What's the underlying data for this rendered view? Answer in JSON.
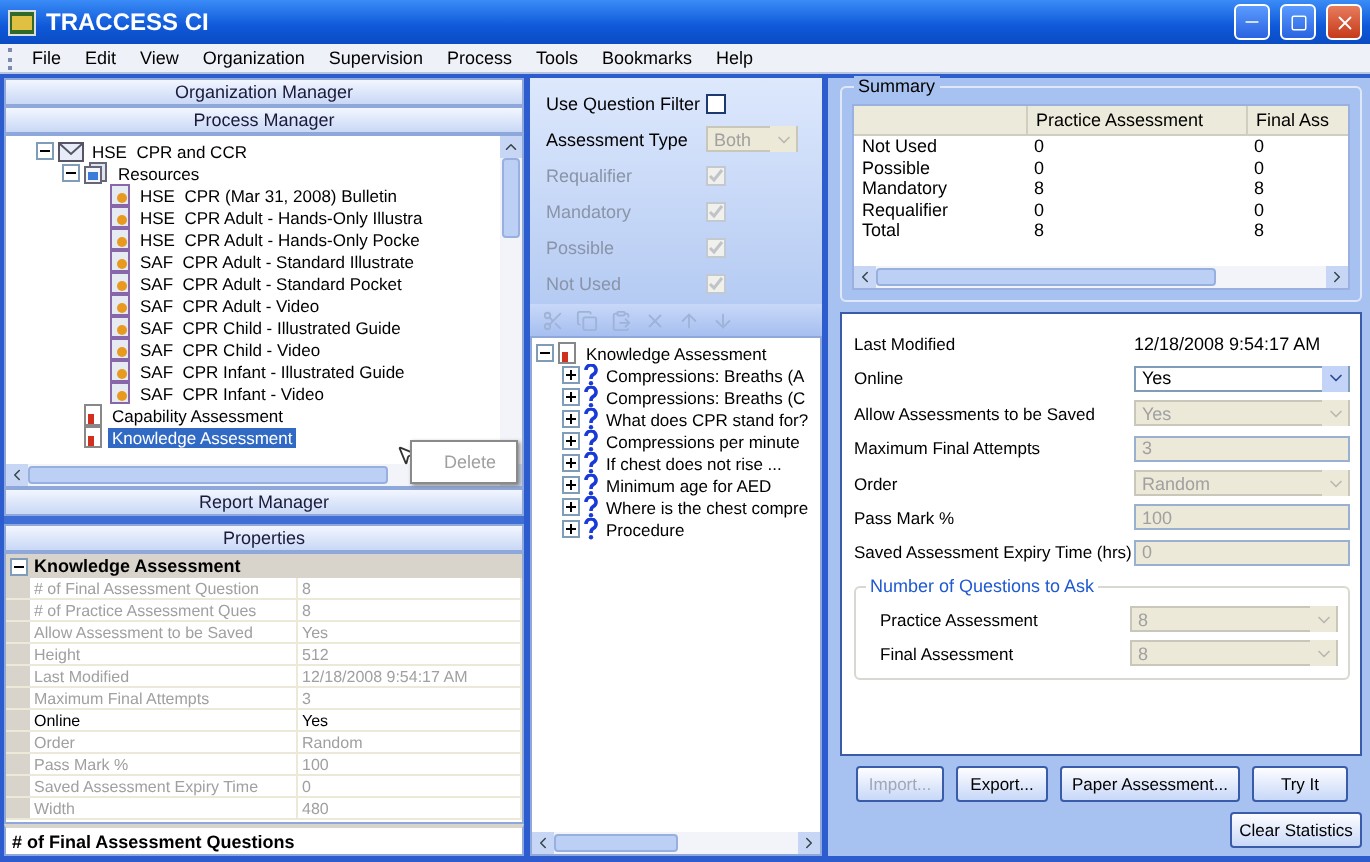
{
  "window": {
    "title": "TRACCESS CI"
  },
  "menu": [
    "File",
    "Edit",
    "View",
    "Organization",
    "Supervision",
    "Process",
    "Tools",
    "Bookmarks",
    "Help"
  ],
  "left_panel": {
    "organization_manager": {
      "title": "Organization Manager"
    },
    "process_manager": {
      "title": "Process Manager",
      "tree": [
        {
          "label": "HSE  CPR and CCR",
          "kind": "course",
          "expanded": true,
          "selected": false,
          "children": [
            {
              "label": "Resources",
              "kind": "folder",
              "expanded": true,
              "selected": false,
              "children": [
                {
                  "label": "HSE  CPR (Mar 31, 2008) Bulletin",
                  "kind": "resource",
                  "selected": false
                },
                {
                  "label": "HSE  CPR Adult - Hands-Only Illustra",
                  "kind": "resource",
                  "selected": false
                },
                {
                  "label": "HSE  CPR Adult - Hands-Only Pocke",
                  "kind": "resource",
                  "selected": false
                },
                {
                  "label": "SAF  CPR Adult - Standard Illustrate",
                  "kind": "resource",
                  "selected": false
                },
                {
                  "label": "SAF  CPR Adult - Standard Pocket",
                  "kind": "resource",
                  "selected": false
                },
                {
                  "label": "SAF  CPR Adult - Video",
                  "kind": "resource",
                  "selected": false
                },
                {
                  "label": "SAF  CPR Child - Illustrated Guide",
                  "kind": "resource",
                  "selected": false
                },
                {
                  "label": "SAF  CPR Child - Video",
                  "kind": "resource",
                  "selected": false
                },
                {
                  "label": "SAF  CPR Infant - Illustrated Guide",
                  "kind": "resource",
                  "selected": false
                },
                {
                  "label": "SAF  CPR Infant - Video",
                  "kind": "resource",
                  "selected": false
                }
              ]
            },
            {
              "label": "Capability Assessment",
              "kind": "assessment",
              "selected": false
            },
            {
              "label": "Knowledge Assessment",
              "kind": "assessment",
              "selected": true
            }
          ]
        }
      ]
    },
    "context_menu": {
      "items": [
        {
          "label": "Delete",
          "disabled": true
        }
      ]
    },
    "report_manager": {
      "title": "Report Manager"
    },
    "properties": {
      "title": "Properties",
      "category": {
        "label": "Knowledge Assessment",
        "expanded": true
      },
      "rows": [
        {
          "name": "# of Final Assessment Question",
          "value": "8",
          "disabled": true
        },
        {
          "name": "# of Practice Assessment Ques",
          "value": "8",
          "disabled": true
        },
        {
          "name": "Allow Assessment to be Saved",
          "value": "Yes",
          "disabled": true
        },
        {
          "name": "Height",
          "value": "512",
          "disabled": true
        },
        {
          "name": "Last Modified",
          "value": "12/18/2008 9:54:17 AM",
          "disabled": true
        },
        {
          "name": "Maximum Final Attempts",
          "value": "3",
          "disabled": true
        },
        {
          "name": "Online",
          "value": "Yes",
          "disabled": false
        },
        {
          "name": "Order",
          "value": "Random",
          "disabled": true
        },
        {
          "name": "Pass Mark %",
          "value": "100",
          "disabled": true
        },
        {
          "name": "Saved Assessment Expiry Time",
          "value": "0",
          "disabled": true
        },
        {
          "name": "Width",
          "value": "480",
          "disabled": true
        }
      ],
      "description": "# of Final Assessment Questions"
    }
  },
  "question_panel": {
    "filter": {
      "use_filter": {
        "label": "Use Question Filter",
        "checked": false
      },
      "assessment_type": {
        "label": "Assessment Type",
        "value": "Both",
        "disabled": true
      },
      "checkboxes": [
        {
          "label": "Requalifier",
          "checked": true,
          "disabled": true
        },
        {
          "label": "Mandatory",
          "checked": true,
          "disabled": true
        },
        {
          "label": "Possible",
          "checked": true,
          "disabled": true
        },
        {
          "label": "Not Used",
          "checked": true,
          "disabled": true
        }
      ]
    },
    "toolbar": [
      {
        "kind": "cut",
        "disabled": true
      },
      {
        "kind": "copy",
        "disabled": true
      },
      {
        "kind": "paste",
        "disabled": true
      },
      {
        "kind": "delete",
        "disabled": true
      },
      {
        "kind": "up",
        "disabled": true
      },
      {
        "kind": "down",
        "disabled": true
      }
    ],
    "tree": [
      {
        "label": "Knowledge Assessment",
        "kind": "assessment",
        "expanded": true,
        "selected": false,
        "children": [
          {
            "label": "Compressions: Breaths (A",
            "kind": "question",
            "expanded": false
          },
          {
            "label": "Compressions: Breaths (C",
            "kind": "question",
            "expanded": false
          },
          {
            "label": "What does CPR stand for?",
            "kind": "question",
            "expanded": false
          },
          {
            "label": "Compressions per minute",
            "kind": "question",
            "expanded": false
          },
          {
            "label": "If chest does not rise ...",
            "kind": "question",
            "expanded": false
          },
          {
            "label": "Minimum age for AED",
            "kind": "question",
            "expanded": false
          },
          {
            "label": "Where is the chest compre",
            "kind": "question",
            "expanded": false
          },
          {
            "label": "Procedure",
            "kind": "question",
            "expanded": false
          }
        ]
      }
    ]
  },
  "summary": {
    "title": "Summary",
    "columns": [
      "Practice Assessment",
      "Final Ass"
    ],
    "rows": [
      {
        "label": "Not Used",
        "values": [
          "0",
          "0"
        ]
      },
      {
        "label": "Possible",
        "values": [
          "0",
          "0"
        ]
      },
      {
        "label": "Mandatory",
        "values": [
          "8",
          "8"
        ]
      },
      {
        "label": "Requalifier",
        "values": [
          "0",
          "0"
        ]
      },
      {
        "label": "Total",
        "values": [
          "8",
          "8"
        ]
      }
    ]
  },
  "details": {
    "fields": [
      {
        "label": "Last Modified",
        "value": "12/18/2008 9:54:17 AM",
        "kind": "text"
      },
      {
        "label": "Online",
        "value": "Yes",
        "kind": "select",
        "disabled": false
      },
      {
        "label": "Allow Assessments to be Saved",
        "value": "Yes",
        "kind": "select",
        "disabled": true
      },
      {
        "label": "Maximum Final Attempts",
        "value": "3",
        "kind": "input",
        "disabled": true
      },
      {
        "label": "Order",
        "value": "Random",
        "kind": "select",
        "disabled": true
      },
      {
        "label": "Pass Mark %",
        "value": "100",
        "kind": "input",
        "disabled": true
      },
      {
        "label": "Saved Assessment Expiry Time (hrs)",
        "value": "0",
        "kind": "input",
        "disabled": true
      }
    ],
    "question_count": {
      "title": "Number of Questions to Ask",
      "fields": [
        {
          "label": "Practice Assessment",
          "value": "8",
          "kind": "select",
          "disabled": true
        },
        {
          "label": "Final Assessment",
          "value": "8",
          "kind": "select",
          "disabled": true
        }
      ]
    }
  },
  "buttons": [
    {
      "label": "Import...",
      "disabled": true
    },
    {
      "label": "Export...",
      "disabled": false
    },
    {
      "label": "Paper Assessment...",
      "disabled": false
    },
    {
      "label": "Try It",
      "disabled": false
    }
  ],
  "secondary_buttons": [
    {
      "label": "Clear Statistics",
      "disabled": false
    }
  ]
}
